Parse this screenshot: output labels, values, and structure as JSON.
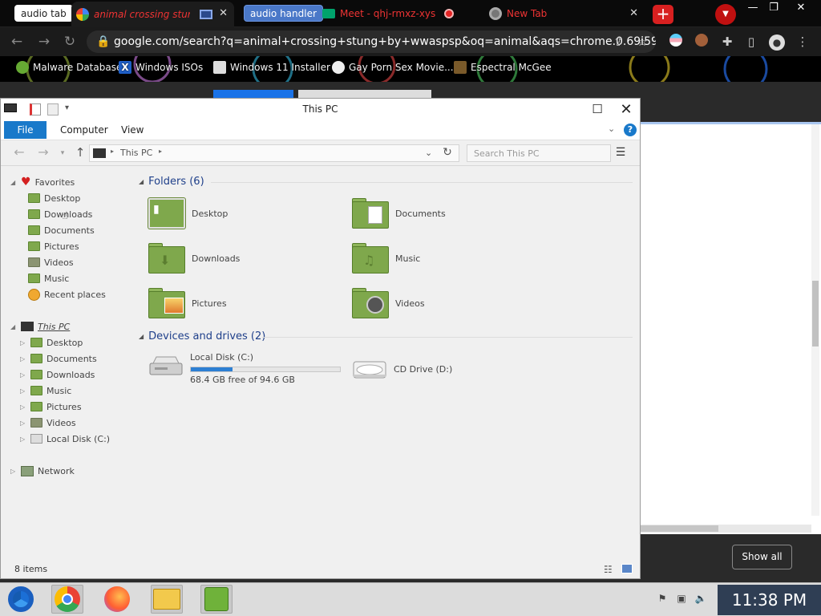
{
  "browser": {
    "tabs": [
      {
        "label": "audio tab",
        "kind": "chip"
      },
      {
        "label": "animal crossing stung",
        "kind": "active"
      },
      {
        "label": "audio handler",
        "kind": "chip-blue"
      },
      {
        "label": "Meet - qhj-rmxz-xys",
        "kind": "tab"
      },
      {
        "label": "New Tab",
        "kind": "tab"
      }
    ],
    "address_url": "google.com/search?q=animal+crossing+stung+by+wwaspsp&oq=animal&aqs=chrome.0.69i59j6…",
    "bookmarks": [
      {
        "label": "Malware Database"
      },
      {
        "label": "Windows ISOs"
      },
      {
        "label": "Windows 11 Installer"
      },
      {
        "label": "Gay Porn Sex Movie..."
      },
      {
        "label": "Espectral McGee"
      }
    ],
    "show_all_label": "Show all",
    "colors": {
      "tab_text": "#e33333",
      "chip_blue": "#4a78c8",
      "new_tab_red": "#d82020"
    }
  },
  "explorer": {
    "title": "This PC",
    "ribbon": {
      "file": "File",
      "computer": "Computer",
      "view": "View",
      "help": "?"
    },
    "address_crumb": "This PC",
    "search_placeholder": "Search This PC",
    "nav": {
      "favorites_label": "Favorites",
      "favorites": [
        "Desktop",
        "Downloads",
        "Documents",
        "Pictures",
        "Videos",
        "Music",
        "Recent places"
      ],
      "thispc_label": "This PC",
      "thispc": [
        "Desktop",
        "Documents",
        "Downloads",
        "Music",
        "Pictures",
        "Videos",
        "Local Disk (C:)"
      ],
      "network_label": "Network"
    },
    "folders_heading": "Folders (6)",
    "folders": [
      {
        "name": "Desktop",
        "icon": "desktop-folder-icon"
      },
      {
        "name": "Documents",
        "icon": "documents-folder-icon"
      },
      {
        "name": "Downloads",
        "icon": "downloads-folder-icon"
      },
      {
        "name": "Music",
        "icon": "music-folder-icon"
      },
      {
        "name": "Pictures",
        "icon": "pictures-folder-icon"
      },
      {
        "name": "Videos",
        "icon": "videos-folder-icon"
      }
    ],
    "drives_heading": "Devices and drives (2)",
    "drives": [
      {
        "name": "Local Disk (C:)",
        "free_text": "68.4 GB free of 94.6 GB",
        "used_fraction": 0.277
      },
      {
        "name": "CD Drive (D:)"
      }
    ],
    "status_items": "8 items",
    "colors": {
      "accent": "#1979ca",
      "heading": "#1e3f8a",
      "folder_green": "#7fa84c",
      "usage_bar": "#2d7fd3"
    }
  },
  "taskbar": {
    "apps": [
      "chromium-icon",
      "chrome-icon",
      "firefox-icon",
      "file-explorer-icon",
      "network-manager-icon"
    ],
    "clock": "11:38 PM",
    "colors": {
      "clock_bg": "#2f3e54"
    }
  }
}
